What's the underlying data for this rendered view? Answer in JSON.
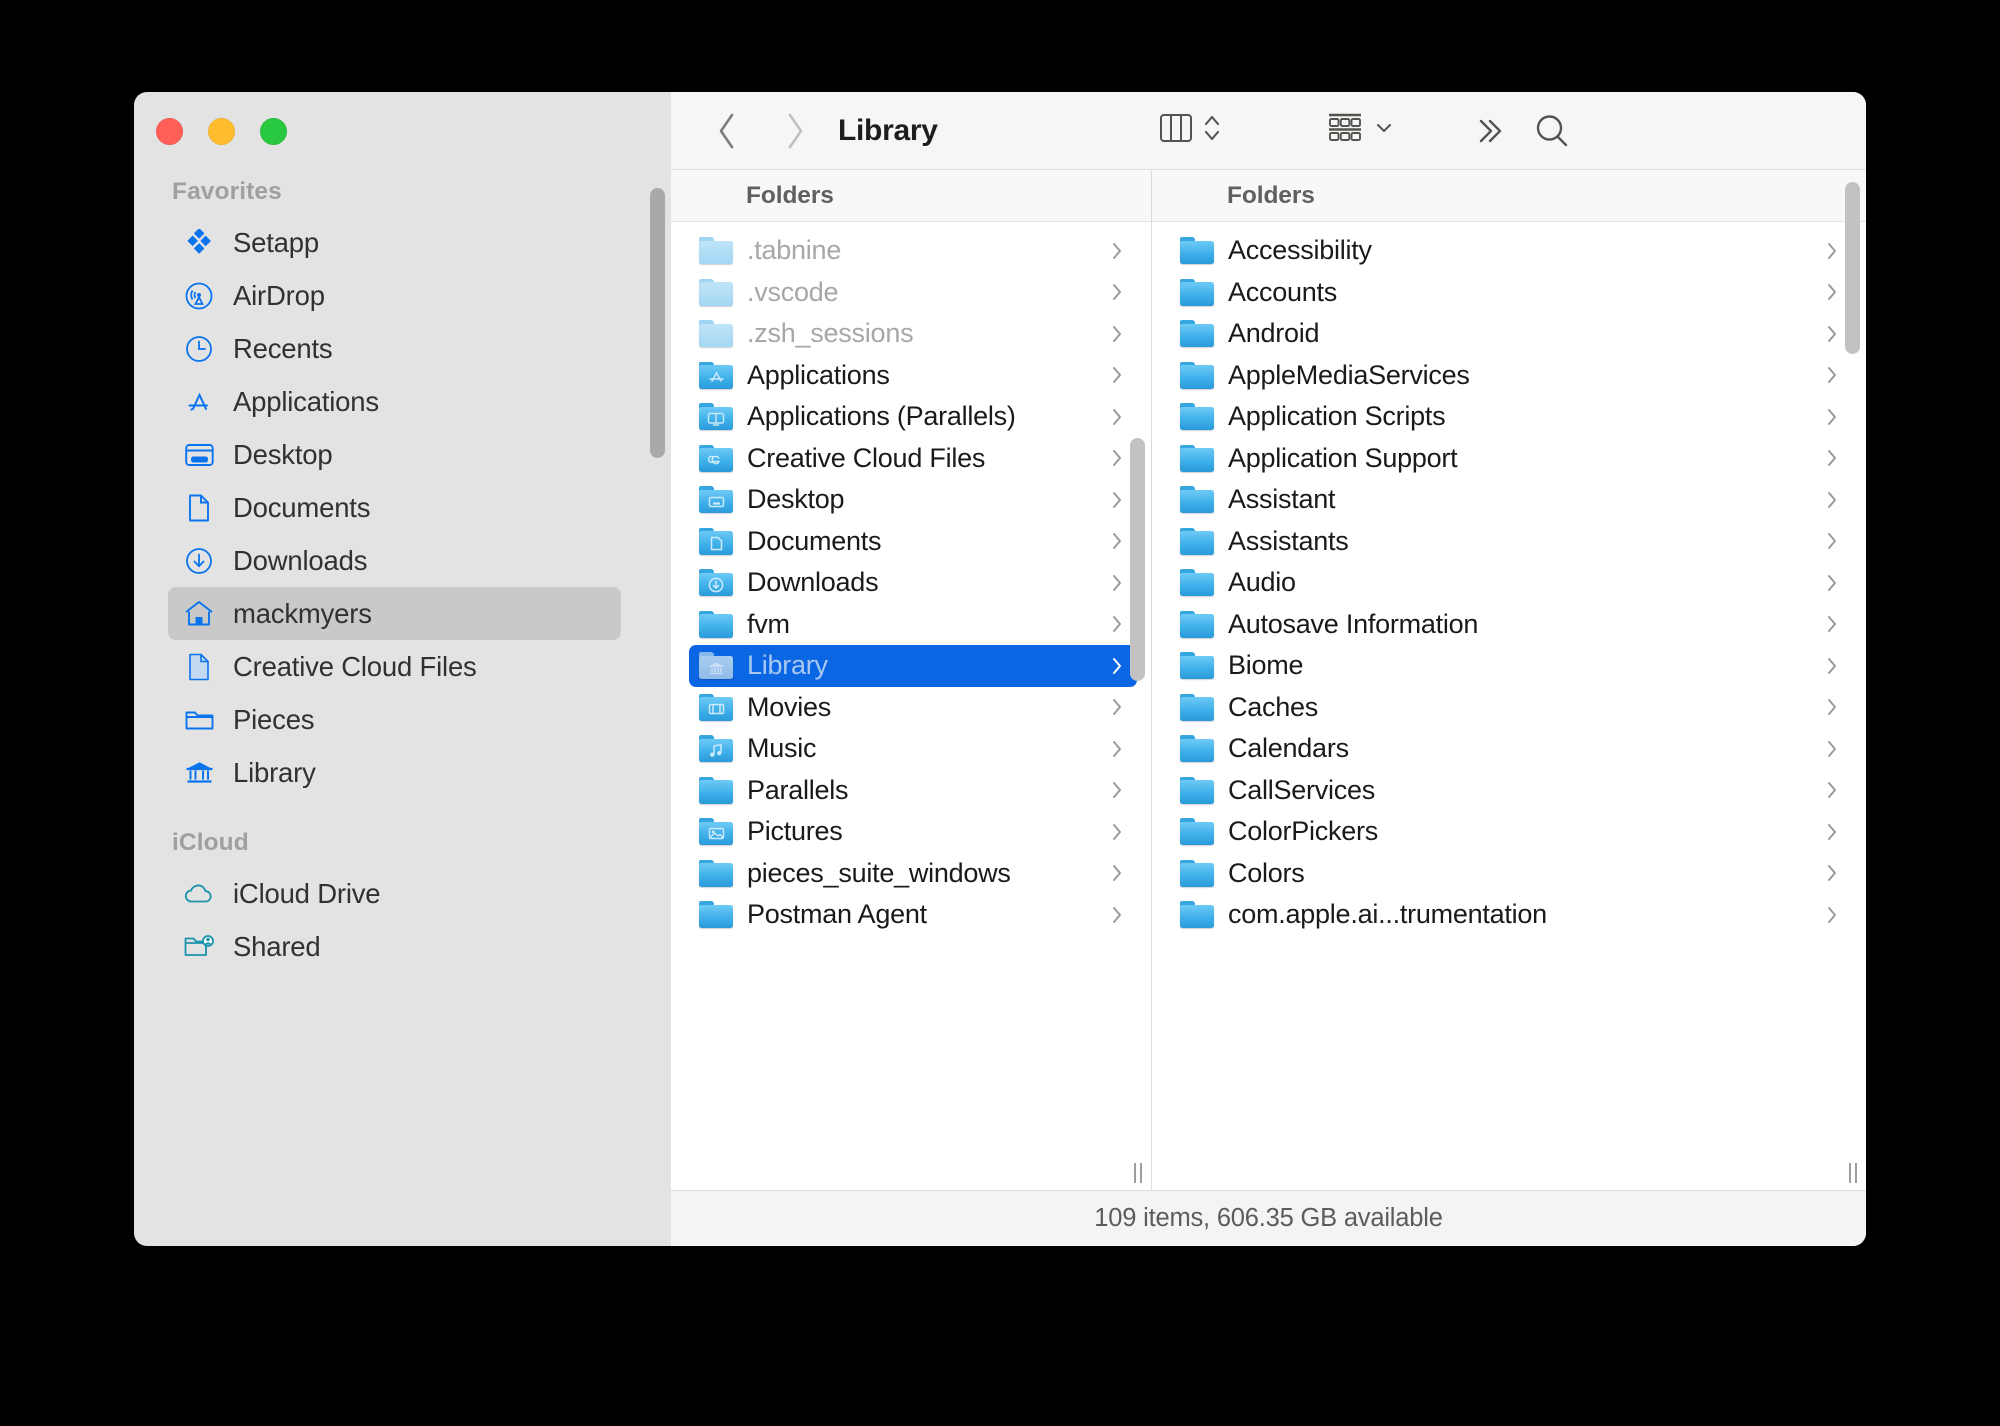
{
  "window": {
    "title": "Library",
    "traffic_lights": [
      {
        "name": "close",
        "color": "#ff5f57"
      },
      {
        "name": "minimize",
        "color": "#febc2e"
      },
      {
        "name": "maximize",
        "color": "#28c840"
      }
    ]
  },
  "toolbar": {
    "back_icon": "chevron-left",
    "forward_icon": "chevron-right",
    "title": "Library",
    "view_icon": "column-view-icon",
    "view_stepper_icon": "up-down-chevron",
    "arrange_icon": "group-items-icon",
    "arrange_chevron_icon": "chevron-down",
    "more_icon": "double-chevron-right",
    "search_icon": "magnifying-glass"
  },
  "sidebar": {
    "groups": [
      {
        "title": "Favorites",
        "items": [
          {
            "label": "Setapp",
            "icon": "setapp-diamond-icon",
            "selected": false
          },
          {
            "label": "AirDrop",
            "icon": "airdrop-icon",
            "selected": false
          },
          {
            "label": "Recents",
            "icon": "clock-icon",
            "selected": false
          },
          {
            "label": "Applications",
            "icon": "app-store-a-icon",
            "selected": false
          },
          {
            "label": "Desktop",
            "icon": "desktop-icon",
            "selected": false
          },
          {
            "label": "Documents",
            "icon": "document-icon",
            "selected": false
          },
          {
            "label": "Downloads",
            "icon": "download-arrow-icon",
            "selected": false
          },
          {
            "label": "mackmyers",
            "icon": "home-house-icon",
            "selected": true
          },
          {
            "label": "Creative Cloud Files",
            "icon": "document-filled-icon",
            "selected": false
          },
          {
            "label": "Pieces",
            "icon": "folder-outline-icon",
            "selected": false
          },
          {
            "label": "Library",
            "icon": "bank-columns-icon",
            "selected": false
          }
        ]
      },
      {
        "title": "iCloud",
        "items": [
          {
            "label": "iCloud Drive",
            "icon": "cloud-icon",
            "selected": false
          },
          {
            "label": "Shared",
            "icon": "folder-person-icon",
            "selected": false
          }
        ]
      }
    ]
  },
  "columns": [
    {
      "header": "Folders",
      "items": [
        {
          "name": ".tabnine",
          "glyph": "",
          "dim": true,
          "selected": false
        },
        {
          "name": ".vscode",
          "glyph": "",
          "dim": true,
          "selected": false
        },
        {
          "name": ".zsh_sessions",
          "glyph": "",
          "dim": true,
          "selected": false
        },
        {
          "name": "Applications",
          "glyph": "appstore",
          "dim": false,
          "selected": false
        },
        {
          "name": "Applications (Parallels)",
          "glyph": "parallels",
          "dim": false,
          "selected": false
        },
        {
          "name": "Creative Cloud Files",
          "glyph": "cc",
          "dim": false,
          "selected": false
        },
        {
          "name": "Desktop",
          "glyph": "desktop",
          "dim": false,
          "selected": false
        },
        {
          "name": "Documents",
          "glyph": "doc",
          "dim": false,
          "selected": false
        },
        {
          "name": "Downloads",
          "glyph": "download",
          "dim": false,
          "selected": false
        },
        {
          "name": "fvm",
          "glyph": "",
          "dim": false,
          "selected": false
        },
        {
          "name": "Library",
          "glyph": "bank",
          "dim": false,
          "selected": true
        },
        {
          "name": "Movies",
          "glyph": "movie",
          "dim": false,
          "selected": false
        },
        {
          "name": "Music",
          "glyph": "music",
          "dim": false,
          "selected": false
        },
        {
          "name": "Parallels",
          "glyph": "",
          "dim": false,
          "selected": false
        },
        {
          "name": "Pictures",
          "glyph": "picture",
          "dim": false,
          "selected": false
        },
        {
          "name": "pieces_suite_windows",
          "glyph": "",
          "dim": false,
          "selected": false
        },
        {
          "name": "Postman Agent",
          "glyph": "",
          "dim": false,
          "selected": false
        }
      ]
    },
    {
      "header": "Folders",
      "items": [
        {
          "name": "Accessibility",
          "glyph": "",
          "dim": false,
          "selected": false
        },
        {
          "name": "Accounts",
          "glyph": "",
          "dim": false,
          "selected": false
        },
        {
          "name": "Android",
          "glyph": "",
          "dim": false,
          "selected": false
        },
        {
          "name": "AppleMediaServices",
          "glyph": "",
          "dim": false,
          "selected": false
        },
        {
          "name": "Application Scripts",
          "glyph": "",
          "dim": false,
          "selected": false
        },
        {
          "name": "Application Support",
          "glyph": "",
          "dim": false,
          "selected": false
        },
        {
          "name": "Assistant",
          "glyph": "",
          "dim": false,
          "selected": false
        },
        {
          "name": "Assistants",
          "glyph": "",
          "dim": false,
          "selected": false
        },
        {
          "name": "Audio",
          "glyph": "",
          "dim": false,
          "selected": false
        },
        {
          "name": "Autosave Information",
          "glyph": "",
          "dim": false,
          "selected": false
        },
        {
          "name": "Biome",
          "glyph": "",
          "dim": false,
          "selected": false
        },
        {
          "name": "Caches",
          "glyph": "",
          "dim": false,
          "selected": false
        },
        {
          "name": "Calendars",
          "glyph": "",
          "dim": false,
          "selected": false
        },
        {
          "name": "CallServices",
          "glyph": "",
          "dim": false,
          "selected": false
        },
        {
          "name": "ColorPickers",
          "glyph": "",
          "dim": false,
          "selected": false
        },
        {
          "name": "Colors",
          "glyph": "",
          "dim": false,
          "selected": false
        },
        {
          "name": "com.apple.ai...trumentation",
          "glyph": "",
          "dim": false,
          "selected": false
        }
      ]
    }
  ],
  "statusbar": {
    "text": "109 items, 606.35 GB available"
  },
  "colors": {
    "selection_blue": "#0a66e2",
    "sidebar_bg": "#e3e3e3",
    "folder_blue": "#3fb0ea",
    "accent_icon_blue": "#007aff"
  }
}
